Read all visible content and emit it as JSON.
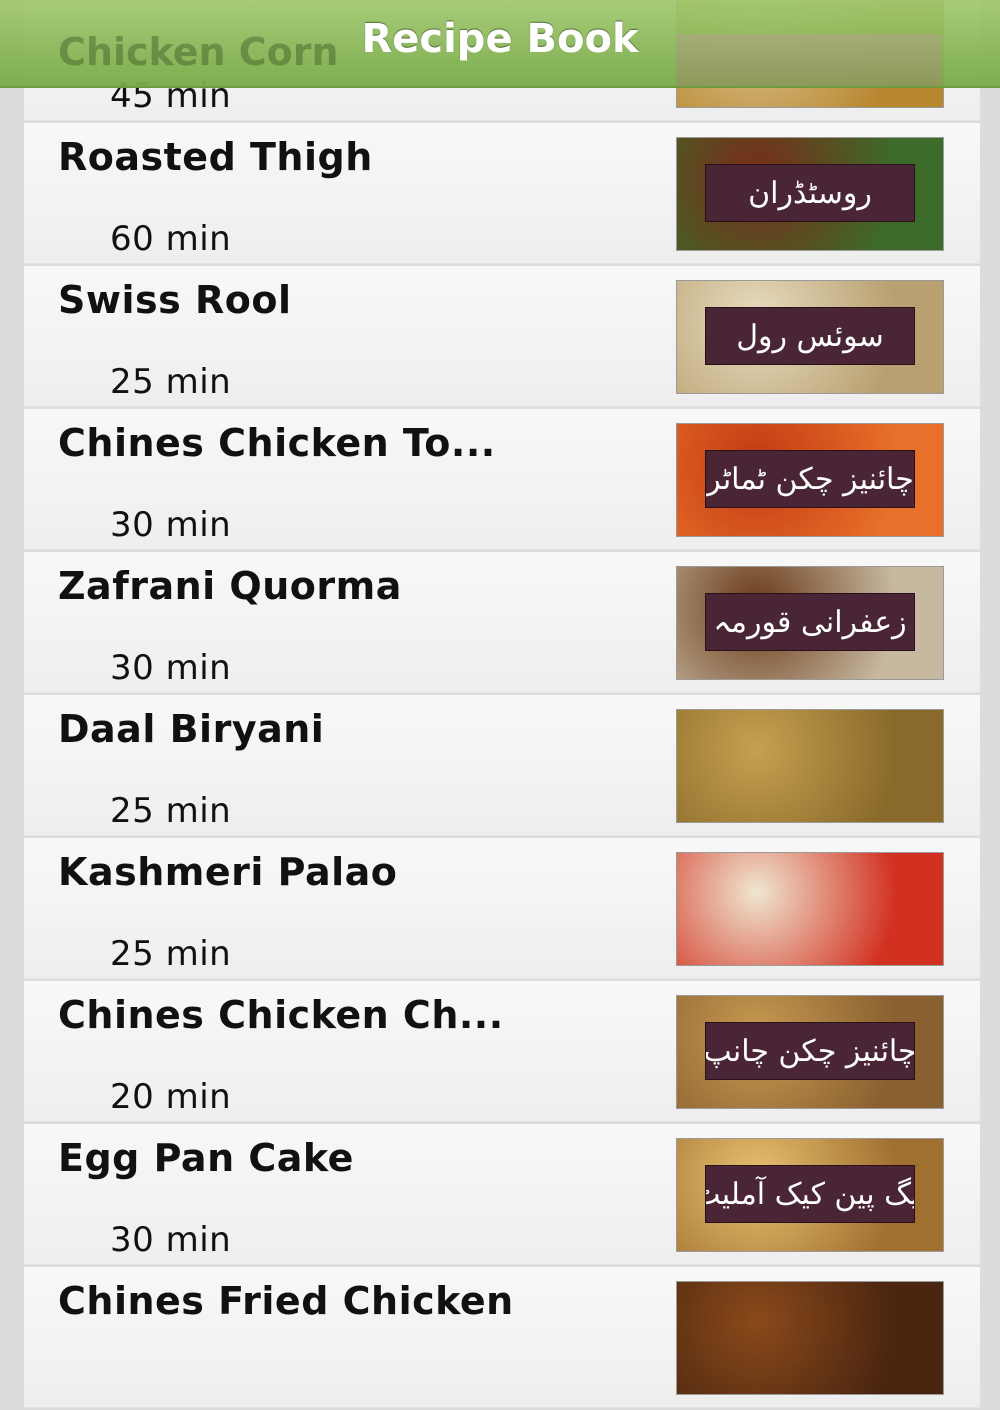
{
  "header": {
    "title": "Recipe Book",
    "partial_row_title": "Chicken Corn"
  },
  "recipes": [
    {
      "title": "",
      "time": "45 min",
      "urdu": "",
      "img": "quiche"
    },
    {
      "title": "Roasted Thigh",
      "time": "60 min",
      "urdu": "روسٹڈران",
      "img": "meat"
    },
    {
      "title": "Swiss Rool",
      "time": "25 min",
      "urdu": "سوئس رول",
      "img": "roll"
    },
    {
      "title": "Chines Chicken To...",
      "time": "30 min",
      "urdu": "چائنیز چکن ٹماٹر",
      "img": "tomato"
    },
    {
      "title": "Zafrani Quorma",
      "time": "30 min",
      "urdu": "زعفرانی قورمہ",
      "img": "curry"
    },
    {
      "title": "Daal Biryani",
      "time": "25 min",
      "urdu": "",
      "img": "rice"
    },
    {
      "title": "Kashmeri Palao",
      "time": "25 min",
      "urdu": "",
      "img": "palao"
    },
    {
      "title": "Chines Chicken Ch...",
      "time": "20 min",
      "urdu": "چائنیز چکن چانپ",
      "img": "chop"
    },
    {
      "title": "Egg Pan Cake",
      "time": "30 min",
      "urdu": "ایگ پین کیک آملیٹ",
      "img": "egg"
    },
    {
      "title": "Chines Fried Chicken",
      "time": "",
      "urdu": "",
      "img": "fried"
    }
  ],
  "image_palette": {
    "quiche": [
      "#d9c08a",
      "#b7862f"
    ],
    "meat": [
      "#7a2a18",
      "#3d6b2a"
    ],
    "roll": [
      "#e8dcc0",
      "#b8a070"
    ],
    "tomato": [
      "#c23a12",
      "#e8702a"
    ],
    "curry": [
      "#6a3a1a",
      "#c7b9a0"
    ],
    "rice": [
      "#c4a050",
      "#8a6a2a"
    ],
    "palao": [
      "#efe6d0",
      "#d23020"
    ],
    "chop": [
      "#c59a50",
      "#8a6030"
    ],
    "egg": [
      "#e8c070",
      "#a07030"
    ],
    "fried": [
      "#8a4a1a",
      "#4a2510"
    ]
  },
  "colors": {
    "header_green": "#8fbf5a",
    "urdu_label_bg": "#4a2535"
  }
}
